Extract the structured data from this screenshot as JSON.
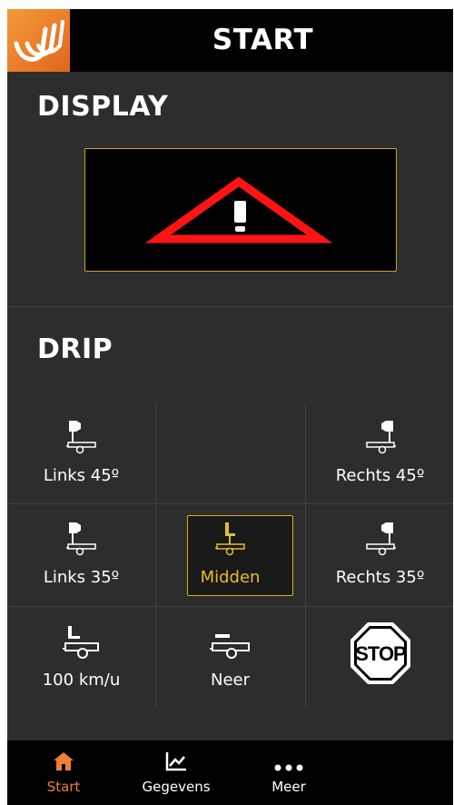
{
  "header": {
    "title": "START",
    "logo_icon": "brand-logo-icon"
  },
  "display": {
    "title": "DISPLAY",
    "screen_icon": "warning-triangle-icon",
    "accent_color": "#caa51f",
    "warning_color": "#ff1414"
  },
  "drip": {
    "title": "DRIP",
    "buttons": [
      {
        "label": "Links 45º",
        "icon": "trailer-sign-left-icon"
      },
      {
        "label": "",
        "icon": ""
      },
      {
        "label": "Rechts 45º",
        "icon": "trailer-sign-right-icon"
      },
      {
        "label": "Links 35º",
        "icon": "trailer-sign-left-icon"
      },
      {
        "label": "Midden",
        "icon": "trailer-sign-middle-icon",
        "selected": true
      },
      {
        "label": "Rechts 35º",
        "icon": "trailer-sign-right-icon"
      },
      {
        "label": "100 km/u",
        "icon": "trailer-raised-icon"
      },
      {
        "label": "Neer",
        "icon": "trailer-lowered-icon"
      },
      {
        "label": "STOP",
        "icon": "stop-sign-icon"
      }
    ],
    "selected_color": "#e3bf2a"
  },
  "nav": {
    "items": [
      {
        "label": "Start",
        "icon": "home-icon",
        "active": true
      },
      {
        "label": "Gegevens",
        "icon": "chart-icon"
      },
      {
        "label": "Meer",
        "icon": "more-dots-icon"
      }
    ],
    "active_color": "#f07d3a"
  }
}
